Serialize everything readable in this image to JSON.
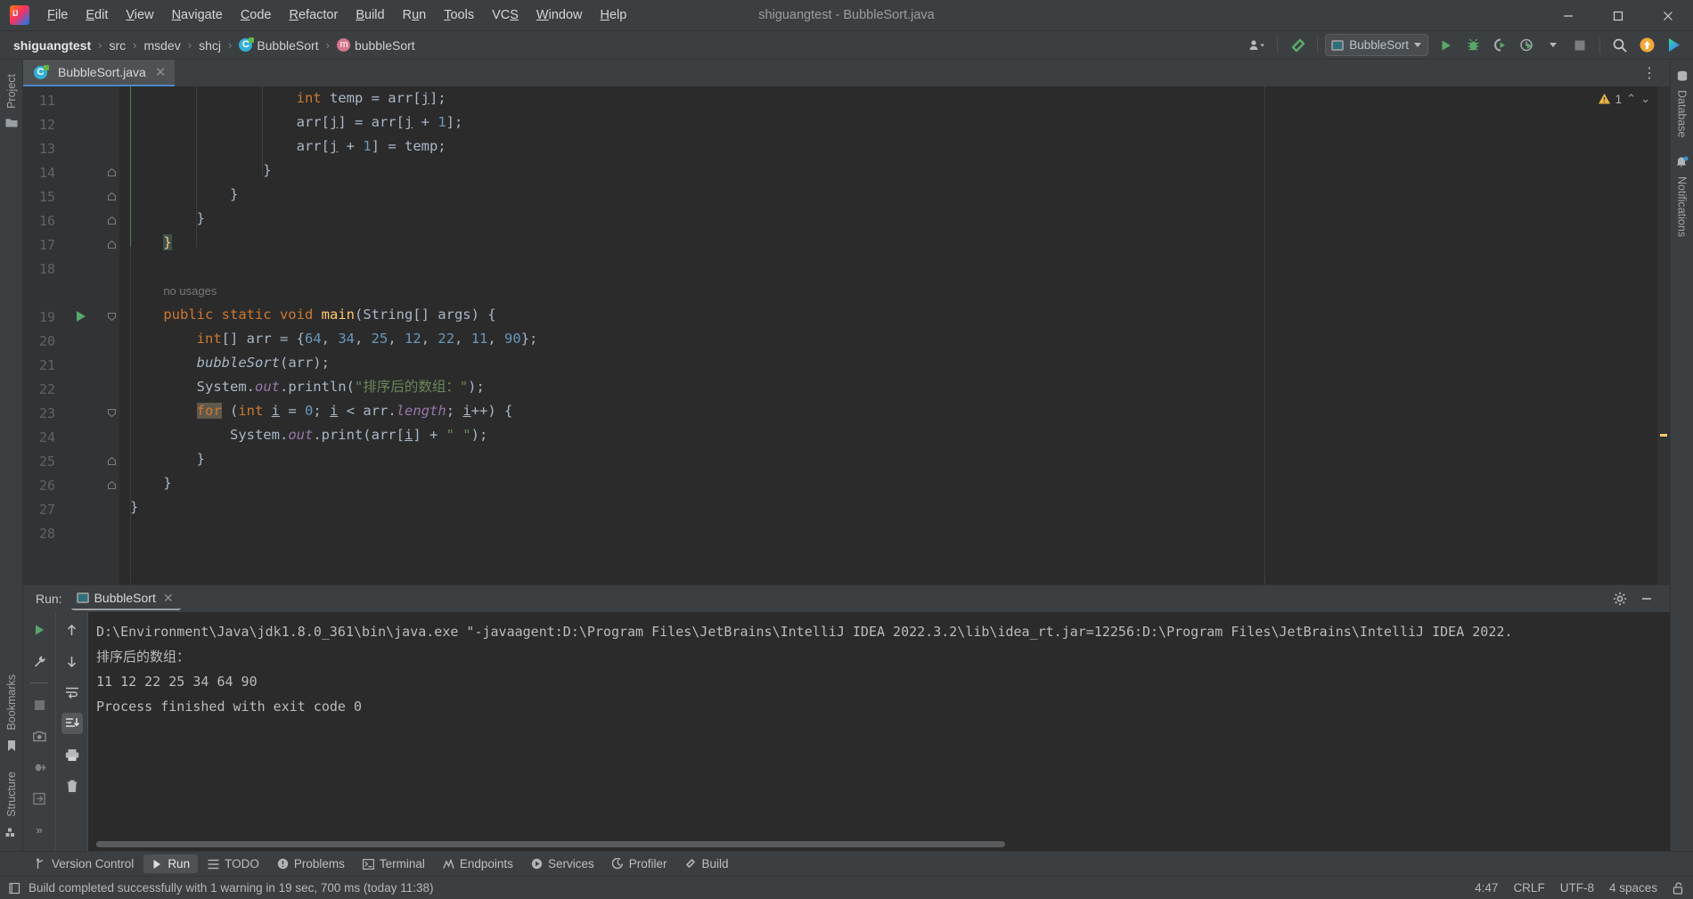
{
  "window": {
    "title": "shiguangtest - BubbleSort.java",
    "minimize_label": "─",
    "maximize_label": "☐",
    "close_label": "✕"
  },
  "menubar": {
    "items": [
      {
        "label": "File"
      },
      {
        "label": "Edit"
      },
      {
        "label": "View"
      },
      {
        "label": "Navigate"
      },
      {
        "label": "Code"
      },
      {
        "label": "Refactor"
      },
      {
        "label": "Build"
      },
      {
        "label": "Run"
      },
      {
        "label": "Tools"
      },
      {
        "label": "VCS"
      },
      {
        "label": "Window"
      },
      {
        "label": "Help"
      }
    ]
  },
  "navbar": {
    "breadcrumbs": [
      {
        "label": "shiguangtest",
        "icon": ""
      },
      {
        "label": "src",
        "icon": ""
      },
      {
        "label": "msdev",
        "icon": ""
      },
      {
        "label": "shcj",
        "icon": ""
      },
      {
        "label": "BubbleSort",
        "icon": "class-icon"
      },
      {
        "label": "bubbleSort",
        "icon": "method-icon"
      }
    ],
    "separator": "›",
    "run_configuration": "BubbleSort",
    "icons": [
      "account-icon",
      "build-hammer-icon",
      "run-icon",
      "debug-icon",
      "run-with-coverage-icon",
      "profiler-icon",
      "stop-icon",
      "search-everywhere-icon",
      "updates-icon",
      "ai-assistant-icon"
    ]
  },
  "left_toolwindows": [
    {
      "label": "Project",
      "icon": "folder-icon"
    },
    {
      "label": "Bookmarks",
      "icon": "bookmark-icon"
    },
    {
      "label": "Structure",
      "icon": "structure-icon"
    }
  ],
  "right_toolwindows": [
    {
      "label": "Database",
      "icon": "database-icon"
    },
    {
      "label": "Notifications",
      "icon": "bell-icon"
    }
  ],
  "editor": {
    "tab": {
      "label": "BubbleSort.java",
      "icon": "java-class-icon",
      "close": "✕"
    },
    "options_icon": "⋮",
    "inspection": {
      "warning_count": "1",
      "up": "˄",
      "down": "˅"
    },
    "first_line_number": 11,
    "lines": [
      {
        "n": 11,
        "fold": "",
        "run": false
      },
      {
        "n": 12,
        "fold": "",
        "run": false
      },
      {
        "n": 13,
        "fold": "",
        "run": false
      },
      {
        "n": 14,
        "fold": "up",
        "run": false
      },
      {
        "n": 15,
        "fold": "up",
        "run": false
      },
      {
        "n": 16,
        "fold": "up",
        "run": false
      },
      {
        "n": 17,
        "fold": "up",
        "run": false
      },
      {
        "n": 18,
        "fold": "",
        "run": false
      },
      {
        "n": 19,
        "fold": "down",
        "run": true
      },
      {
        "n": 20,
        "fold": "",
        "run": false
      },
      {
        "n": 21,
        "fold": "",
        "run": false
      },
      {
        "n": 22,
        "fold": "",
        "run": false
      },
      {
        "n": 23,
        "fold": "down",
        "run": false
      },
      {
        "n": 24,
        "fold": "",
        "run": false
      },
      {
        "n": 25,
        "fold": "up",
        "run": false
      },
      {
        "n": 26,
        "fold": "up",
        "run": false
      },
      {
        "n": 27,
        "fold": "",
        "run": false
      },
      {
        "n": 28,
        "fold": "",
        "run": false
      }
    ],
    "code_text": "                    int temp = arr[j];\n                    arr[j] = arr[j + 1];\n                    arr[j + 1] = temp;\n                }\n            }\n        }\n    }\n\n    no usages\n    public static void main(String[] args) {\n        int[] arr = {64, 34, 25, 12, 22, 11, 90};\n        bubbleSort(arr);\n        System.out.println(\"排序后的数组：\");\n        for (int i = 0; i < arr.length; i++) {\n            System.out.print(arr[i] + \" \");\n        }\n    }\n}\n",
    "inlay_hint": "no usages"
  },
  "run_panel": {
    "label": "Run:",
    "tab_label": "BubbleSort",
    "tab_close": "✕",
    "settings_icon": "gear-icon",
    "minimize_icon": "─",
    "left_tools": [
      "rerun-icon",
      "wrench-icon",
      "stop-icon",
      "camera-icon",
      "dump-threads-icon",
      "exit-icon",
      "more-icon"
    ],
    "right_tools": [
      "up-arrow-icon",
      "down-arrow-icon",
      "soft-wrap-icon",
      "scroll-to-end-icon",
      "print-icon",
      "trash-icon"
    ],
    "console_lines": [
      "D:\\Environment\\Java\\jdk1.8.0_361\\bin\\java.exe \"-javaagent:D:\\Program Files\\JetBrains\\IntelliJ IDEA 2022.3.2\\lib\\idea_rt.jar=12256:D:\\Program Files\\JetBrains\\IntelliJ IDEA 2022.",
      "排序后的数组：",
      "11 12 22 25 34 64 90",
      "Process finished with exit code 0"
    ]
  },
  "bottom_toolwindows": [
    {
      "label": "Version Control",
      "icon": "vcs-icon",
      "active": false
    },
    {
      "label": "Run",
      "icon": "run-icon",
      "active": true
    },
    {
      "label": "TODO",
      "icon": "todo-icon",
      "active": false
    },
    {
      "label": "Problems",
      "icon": "problems-icon",
      "active": false
    },
    {
      "label": "Terminal",
      "icon": "terminal-icon",
      "active": false
    },
    {
      "label": "Endpoints",
      "icon": "endpoints-icon",
      "active": false
    },
    {
      "label": "Services",
      "icon": "services-icon",
      "active": false
    },
    {
      "label": "Profiler",
      "icon": "profiler-icon",
      "active": false
    },
    {
      "label": "Build",
      "icon": "build-icon",
      "active": false
    }
  ],
  "statusbar": {
    "message": "Build completed successfully with 1 warning in 19 sec, 700 ms (today 11:38)",
    "message_icon": "build-status-icon",
    "caret_position": "4:47",
    "line_separator": "CRLF",
    "encoding": "UTF-8",
    "indent": "4 spaces",
    "lock_icon": "unlocked-icon"
  },
  "colors": {
    "accent_blue": "#4a88c7",
    "run_green": "#59a869",
    "warning_yellow": "#ffc66d",
    "keyword_orange": "#cc7832",
    "string_green": "#6a8759",
    "number_blue": "#6897bb",
    "method_yellow": "#ffc66d",
    "field_purple": "#9876aa",
    "editor_bg": "#2b2b2b",
    "chrome_bg": "#3c3f41"
  }
}
